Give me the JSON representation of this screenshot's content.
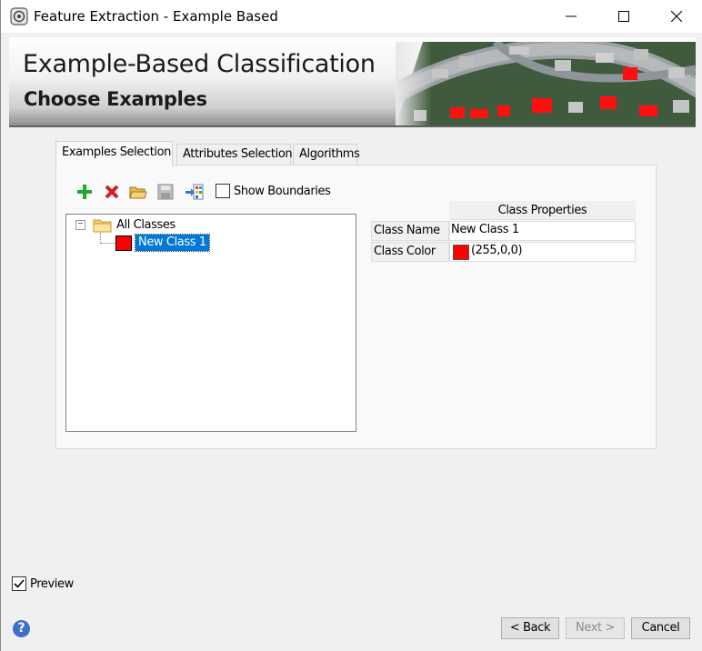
{
  "window": {
    "title": "Feature Extraction - Example Based"
  },
  "banner": {
    "title": "Example-Based Classification",
    "subtitle": "Choose Examples"
  },
  "tabs": [
    {
      "label": "Examples Selection",
      "active": true
    },
    {
      "label": "Attributes Selection",
      "active": false
    },
    {
      "label": "Algorithms",
      "active": false
    }
  ],
  "toolbar": {
    "icons": [
      "add-class-icon",
      "delete-class-icon",
      "open-folder-icon",
      "save-icon",
      "import-icon"
    ],
    "show_boundaries_label": "Show Boundaries",
    "show_boundaries_checked": false
  },
  "tree": {
    "root_label": "All Classes",
    "items": [
      {
        "label": "New Class 1",
        "color": "#ff0000",
        "selected": true
      }
    ]
  },
  "properties": {
    "header": "Class Properties",
    "rows": [
      {
        "name": "Class Name",
        "value": "New Class 1"
      },
      {
        "name": "Class Color",
        "value": "(255,0,0)",
        "color": "#ff0000"
      }
    ]
  },
  "footer": {
    "preview_label": "Preview",
    "preview_checked": true,
    "back_label": "< Back",
    "next_label": "Next >",
    "cancel_label": "Cancel"
  },
  "colors": {
    "selection": "#0078d7",
    "class_color": "#ff0000",
    "help": "#3d6fc9"
  }
}
